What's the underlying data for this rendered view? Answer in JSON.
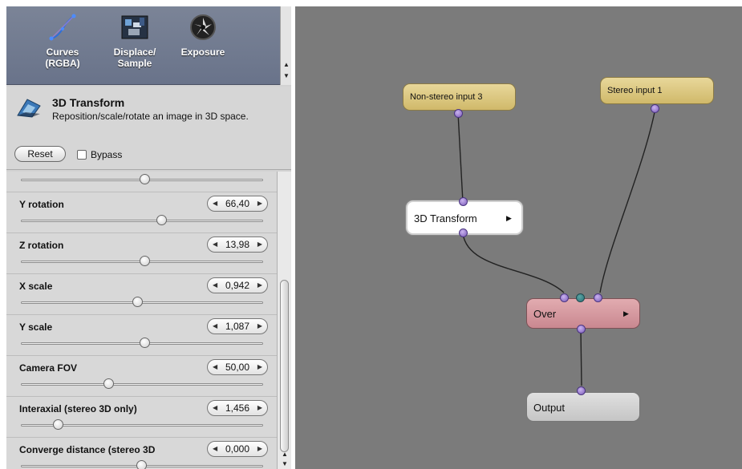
{
  "effects_strip": {
    "items": [
      {
        "label_line1": "Curves (RGBA)",
        "label_line2": "",
        "icon": "curves-icon"
      },
      {
        "label_line1": "Displace/",
        "label_line2": "Sample",
        "icon": "displace-sample-icon"
      },
      {
        "label_line1": "Exposure",
        "label_line2": "",
        "icon": "exposure-icon"
      }
    ]
  },
  "node_info": {
    "title": "3D Transform",
    "description": "Reposition/scale/rotate an image in 3D space.",
    "reset_label": "Reset",
    "bypass_label": "Bypass",
    "bypass_checked": false
  },
  "params": [
    {
      "label": "",
      "value": "",
      "slider": 0.5
    },
    {
      "label": "Y rotation",
      "value": "66,40",
      "slider": 0.58
    },
    {
      "label": "Z rotation",
      "value": "13,98",
      "slider": 0.52
    },
    {
      "label": "X scale",
      "value": "0,942",
      "slider": 0.48
    },
    {
      "label": "Y scale",
      "value": "1,087",
      "slider": 0.52
    },
    {
      "label": "Camera FOV",
      "value": "50,00",
      "slider": 0.36
    },
    {
      "label": "Interaxial (stereo 3D only)",
      "value": "1,456",
      "slider": 0.15
    },
    {
      "label": "Converge distance (stereo 3D",
      "value": "0,000",
      "slider": 0.5
    }
  ],
  "graph": {
    "nodes": [
      {
        "id": "non-stereo-input-3",
        "label": "Non-stereo input 3",
        "color": "#d8c27a"
      },
      {
        "id": "stereo-input-1",
        "label": "Stereo input 1",
        "color": "#d8c27a"
      },
      {
        "id": "3d-transform",
        "label": "3D Transform",
        "color": "#ffffff"
      },
      {
        "id": "over",
        "label": "Over",
        "color": "#d59aa0"
      },
      {
        "id": "output",
        "label": "Output",
        "color": "#cfcfcf"
      }
    ]
  },
  "colors": {
    "canvas_bg": "#7b7b7b",
    "panel_bg": "#d2d2d2",
    "strip_bg": "#6e778c",
    "input_node": "#d8c27a",
    "over_node": "#d59aa0",
    "port": "#9b7fd6"
  }
}
